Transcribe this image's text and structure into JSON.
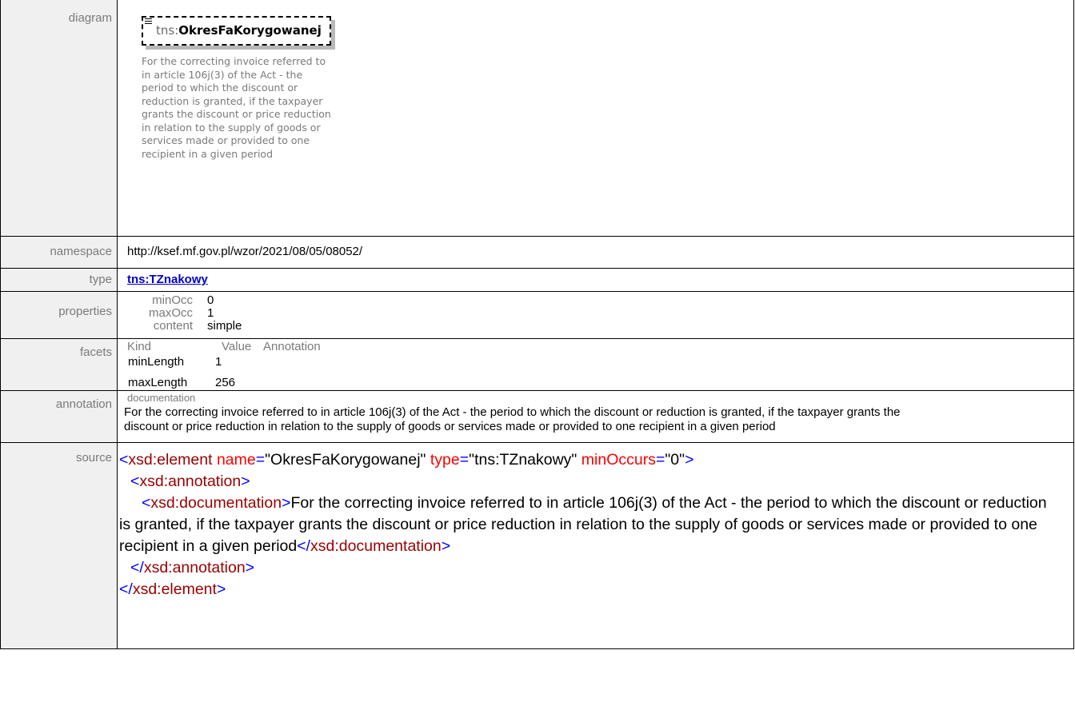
{
  "labels": {
    "diagram": "diagram",
    "namespace": "namespace",
    "type": "type",
    "properties": "properties",
    "facets": "facets",
    "annotation": "annotation",
    "source": "source"
  },
  "diagram": {
    "prefix": "tns:",
    "name": "OkresFaKorygowanej",
    "documentation": "For the correcting invoice referred to\nin article 106j(3) of the Act - the\nperiod to which the discount or\nreduction is granted, if the taxpayer\ngrants the discount or price reduction\nin relation to the supply of goods or\nservices made or provided to one\nrecipient in a given period"
  },
  "namespace": "http://ksef.mf.gov.pl/wzor/2021/08/05/08052/",
  "type": "tns:TZnakowy",
  "properties": [
    {
      "key": "minOcc",
      "value": "0"
    },
    {
      "key": "maxOcc",
      "value": "1"
    },
    {
      "key": "content",
      "value": "simple"
    }
  ],
  "facets": {
    "headers": [
      "Kind",
      "Value",
      "Annotation"
    ],
    "rows": [
      {
        "kind": "minLength",
        "value": "1"
      },
      {
        "kind": "maxLength",
        "value": "256"
      }
    ]
  },
  "annotation": {
    "label": "documentation",
    "text": "For the correcting invoice referred to in article 106j(3) of the Act - the period to which the discount or reduction is granted, if the taxpayer grants the discount or price reduction in relation to the supply of goods or services made or provided to one recipient in a given period"
  },
  "source": {
    "open_lt": "<",
    "element_tag": "xsd:element",
    "attr_name": "name",
    "attr_name_val": "\"OkresFaKorygowanej\"",
    "attr_type": "type",
    "attr_type_val": "\"tns:TZnakowy\"",
    "attr_minoccurs": "minOccurs",
    "attr_minoccurs_val": "\"0\"",
    "eq": "=",
    "gt": ">",
    "sp": " ",
    "annotation_tag": "xsd:annotation",
    "documentation_tag": "xsd:documentation",
    "doc_text": "For the correcting invoice referred to in article 106j(3) of the Act - the period to which the discount or reduction is granted, if the taxpayer grants the discount or price reduction in relation to the supply of goods or services made or provided to one recipient in a given period",
    "close_lt": "</"
  }
}
